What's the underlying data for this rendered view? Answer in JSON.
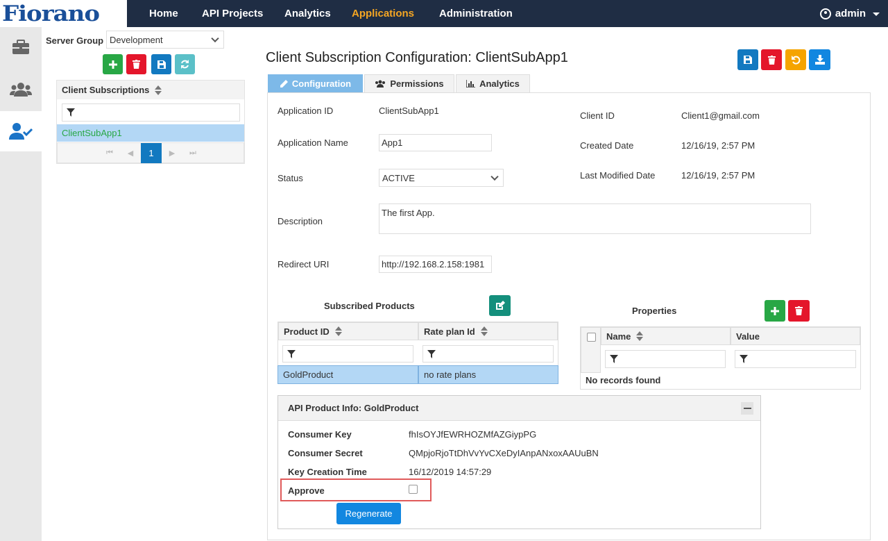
{
  "brand": {
    "logo_text": "Fiorano"
  },
  "nav": {
    "home": "Home",
    "api_projects": "API Projects",
    "analytics": "Analytics",
    "applications": "Applications",
    "administration": "Administration",
    "user": "admin"
  },
  "sidebar": {
    "server_group_label": "Server Group",
    "server_group_value": "Development",
    "list_header": "Client Subscriptions",
    "items": [
      "ClientSubApp1"
    ],
    "pager": {
      "current_page": "1"
    }
  },
  "main": {
    "title": "Client Subscription Configuration: ClientSubApp1",
    "tabs": [
      "Configuration",
      "Permissions",
      "Analytics"
    ],
    "fields": {
      "application_id_label": "Application ID",
      "application_id": "ClientSubApp1",
      "application_name_label": "Application Name",
      "application_name": "App1",
      "status_label": "Status",
      "status": "ACTIVE",
      "description_label": "Description",
      "description": "The first App.",
      "redirect_uri_label": "Redirect URI",
      "redirect_uri": "http://192.168.2.158:1981",
      "client_id_label": "Client ID",
      "client_id": "Client1@gmail.com",
      "created_date_label": "Created Date",
      "created_date": "12/16/19, 2:57 PM",
      "last_modified_label": "Last Modified Date",
      "last_modified": "12/16/19, 2:57 PM"
    },
    "subscribed_products": {
      "title": "Subscribed Products",
      "columns": [
        "Product ID",
        "Rate plan Id"
      ],
      "rows": [
        [
          "GoldProduct",
          "no rate plans"
        ]
      ]
    },
    "properties": {
      "title": "Properties",
      "columns": [
        "Name",
        "Value"
      ],
      "empty_text": "No records found"
    },
    "product_info": {
      "title": "API Product Info: GoldProduct",
      "consumer_key_label": "Consumer Key",
      "consumer_key": "fhIsOYJfEWRHOZMfAZGiypPG",
      "consumer_secret_label": "Consumer Secret",
      "consumer_secret": "QMpjoRjoTtDhVvYvCXeDyIAnpANxoxAAUuBN",
      "key_creation_label": "Key Creation Time",
      "key_creation": "16/12/2019 14:57:29",
      "approve_label": "Approve",
      "approve_checked": false,
      "regenerate_label": "Regenerate"
    }
  },
  "colors": {
    "topbar": "#1f2d44",
    "accent": "#f5a623",
    "primary": "#1279c0",
    "success": "#28a745",
    "danger": "#e4162b"
  }
}
